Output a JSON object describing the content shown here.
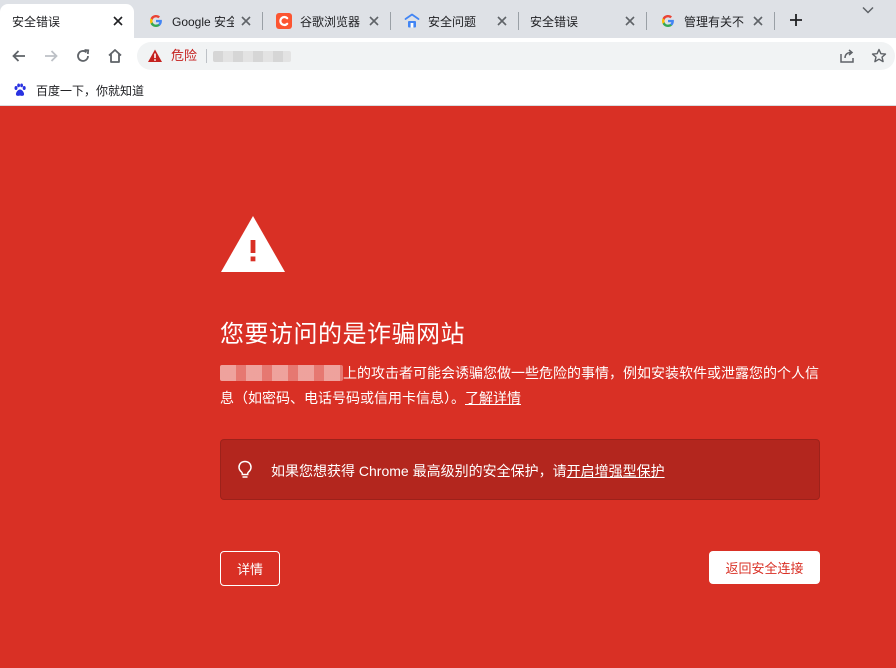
{
  "tabs": [
    {
      "title": "安全错误",
      "favicon": "none",
      "active": true
    },
    {
      "title": "Google 安全",
      "favicon": "google-g-icon",
      "active": false
    },
    {
      "title": "谷歌浏览器",
      "favicon": "csdn-c-icon",
      "active": false
    },
    {
      "title": "安全问题",
      "favicon": "chrome-help-icon",
      "active": false
    },
    {
      "title": "安全错误",
      "favicon": "none",
      "active": false
    },
    {
      "title": "管理有关不",
      "favicon": "google-g-icon",
      "active": false
    }
  ],
  "toolbar": {
    "security_chip": "危险",
    "icons": [
      "back-arrow-icon",
      "forward-arrow-icon",
      "reload-icon",
      "home-icon",
      "warning-triangle-icon",
      "share-icon",
      "star-icon"
    ]
  },
  "bookmarks": [
    {
      "label": "百度一下，你就知道",
      "icon": "baidu-paw-icon"
    }
  ],
  "interstitial": {
    "headline": "您要访问的是诈骗网站",
    "description_main": "上的攻击者可能会诱骗您做一些危险的事情，例如安装软件或泄露您的个人信息（如密码、电话号码或信用卡信息）。",
    "learn_more": "了解详情",
    "tip_prefix": "如果您想获得 Chrome 最高级别的安全保护，请",
    "tip_link": "开启增强型保护",
    "details_button": "详情",
    "back_button": "返回安全连接"
  },
  "colors": {
    "danger_red": "#d93025",
    "tip_bg": "#b3261e",
    "tab_strip": "#dee1e6",
    "omnibox": "#f1f3f4"
  }
}
